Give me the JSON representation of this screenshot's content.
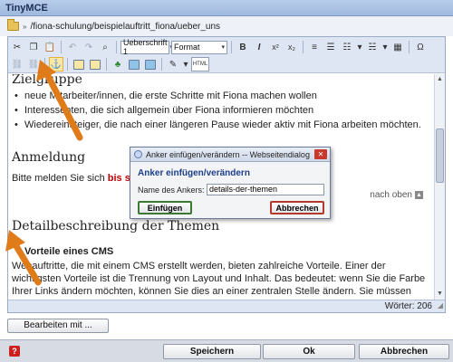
{
  "window": {
    "title": "TinyMCE"
  },
  "path": {
    "text": "/fiona-schulung/beispielauftritt_fiona/ueber_uns"
  },
  "toolbar": {
    "style_select": "Ueberschrift 1",
    "format_select": "Format",
    "bold": "B",
    "italic": "I",
    "superscript": "x²",
    "subscript": "x₂",
    "omega": "Ω",
    "html": "HTML",
    "anchor": "⚓"
  },
  "content": {
    "heading_ziel": "Zielgruppe",
    "bullets": [
      "neue Mitarbeiter/innen, die erste Schritte mit Fiona machen wollen",
      "Interessenten, die sich allgemein über Fiona informieren möchten",
      "Wiedereinsteiger, die nach einer längeren Pause wieder aktiv mit Fiona arbeiten möchten."
    ],
    "heading_anmeldung": "Anmeldung",
    "bitte_text": "Bitte melden Sie sich ",
    "bitte_red": "bis spätes",
    "nach_oben": "nach oben",
    "heading_detail": "Detailbeschreibung der Themen",
    "heading_vorteile": "Vorteile eines CMS",
    "paragraph": "Webauftritte, die mit einem CMS erstellt werden, bieten zahlreiche Vorteile. Einer der wichtigsten Vorteile ist die Trennung von Layout und Inhalt. Das bedeutet: wenn Sie die Farbe Ihrer Links ändern möchten, können Sie dies an einer zentralen Stelle ändern. Sie müssen nicht jeden einzelnen Link umfärben."
  },
  "status": {
    "word_count": "Wörter: 206"
  },
  "buttons": {
    "bearbeiten": "Bearbeiten mit ...",
    "speichern": "Speichern",
    "ok": "Ok",
    "abbrechen": "Abbrechen"
  },
  "dialog": {
    "title": "Anker einfügen/verändern -- Webseitendialog",
    "heading": "Anker einfügen/verändern",
    "label": "Name des Ankers:",
    "value": "details-der-themen",
    "insert": "Einfügen",
    "cancel": "Abbrechen"
  },
  "colors": {
    "accent": "#1d3f8a",
    "highlight_red": "#c00000",
    "arrow": "#e07b1a"
  }
}
